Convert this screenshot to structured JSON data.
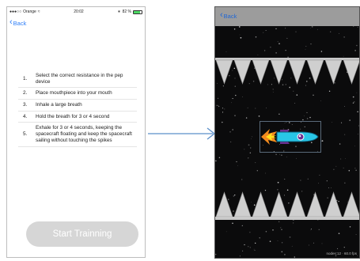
{
  "left_screen": {
    "status_bar": {
      "carrier": "Orange",
      "time": "20:02",
      "battery": "82 %"
    },
    "nav": {
      "back_label": "Back"
    },
    "steps": [
      {
        "number": "1.",
        "text": "Select the correct resistance in the pep device"
      },
      {
        "number": "2.",
        "text": "Place mouthpiece into your mouth"
      },
      {
        "number": "3.",
        "text": "Inhale a large breath"
      },
      {
        "number": "4.",
        "text": "Hold the breath for 3 or 4 second"
      },
      {
        "number": "5.",
        "text": "Exhale for 3 or 4 seconds, keeping the spacecraft floating and keep the spacecraft sailing without touching the spikes"
      }
    ],
    "start_button_label": "Start Trainning"
  },
  "right_screen": {
    "nav": {
      "back_label": "Back"
    },
    "coords_readout": "nodes:12 · 60.0 fps",
    "colors": {
      "accent": "#2d7ef7",
      "disabled_button": "#d6d6d6",
      "game_header": "#9c9c9c",
      "space_background": "#0b0b0c",
      "ship_body": "#29c6e6",
      "ship_fin": "#6b2e8f",
      "flame_outer": "#f28a1e",
      "flame_inner": "#ffe21c"
    },
    "icons": [
      "chevron-left-icon",
      "spike-icon",
      "rocket-icon",
      "flame-icon"
    ]
  }
}
